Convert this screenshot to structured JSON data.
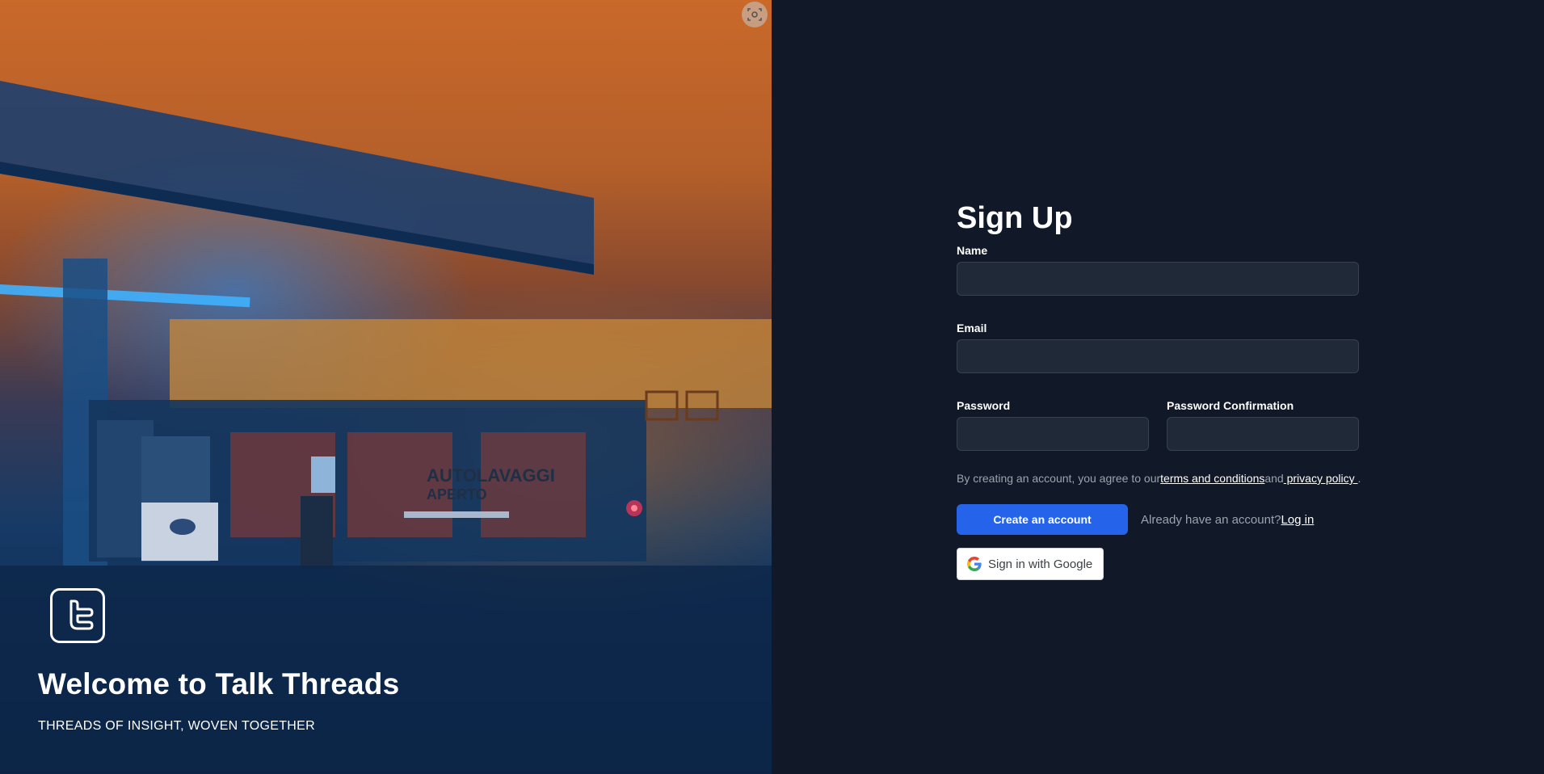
{
  "hero": {
    "title": "Welcome to Talk Threads",
    "tagline": "THREADS OF INSIGHT, WOVEN TOGETHER",
    "logo_icon": "talk-threads-logo-icon",
    "background_sign_1": "AUTOLAVAGGI",
    "background_sign_2": "APERTO"
  },
  "form": {
    "title": "Sign Up",
    "name_label": "Name",
    "name_value": "",
    "email_label": "Email",
    "email_value": "",
    "password_label": "Password",
    "password_value": "",
    "password_confirm_label": "Password Confirmation",
    "password_confirm_value": "",
    "terms_prefix": "By creating an account, you agree to our",
    "terms_link": "terms and conditions",
    "terms_and": "and",
    "privacy_link": " privacy policy ",
    "terms_suffix": ".",
    "create_button": "Create an account",
    "have_account_text": "Already have an account?",
    "login_link": "Log in",
    "google_button": "Sign in with Google"
  },
  "colors": {
    "panel_bg": "#111827",
    "input_bg": "#1f2937",
    "primary": "#2563eb",
    "muted_text": "#9ca3af"
  }
}
